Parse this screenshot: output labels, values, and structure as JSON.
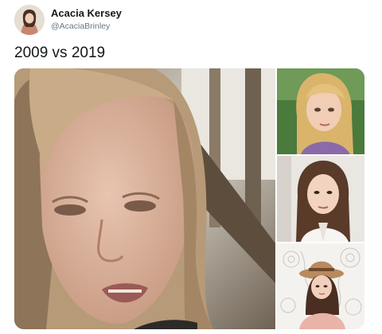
{
  "user": {
    "name": "Acacia Kersey",
    "handle": "@AcaciaBrinley"
  },
  "tweet": {
    "text": "2009 vs 2019"
  },
  "media": {
    "photos": [
      {
        "caption": "",
        "subject": "girl-2009-closeup"
      },
      {
        "caption": "",
        "subject": "girl-2009-portrait"
      },
      {
        "caption": "",
        "subject": "woman-2019-portrait"
      },
      {
        "caption": "",
        "subject": "woman-2019-hat"
      }
    ]
  },
  "colors": {
    "text": "#14171a",
    "secondary": "#657786",
    "background": "#ffffff"
  }
}
